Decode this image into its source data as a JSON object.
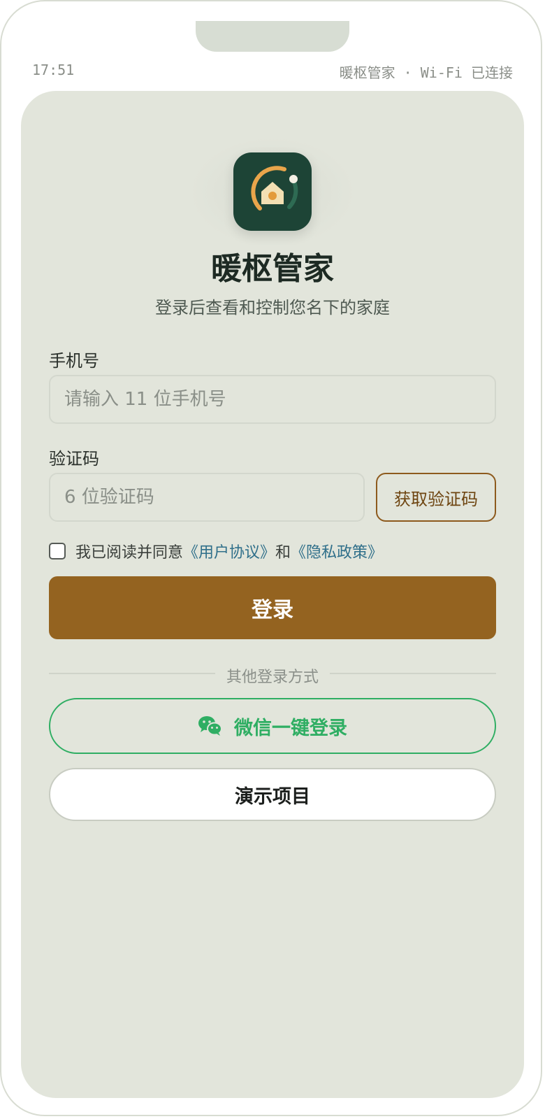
{
  "status_bar": {
    "time": "17:51",
    "right_text": "暖枢管家 · Wi-Fi 已连接"
  },
  "app": {
    "title": "暖枢管家",
    "subtitle": "登录后查看和控制您名下的家庭",
    "logo_icon": "home-gauge-icon"
  },
  "form": {
    "phone_label": "手机号",
    "phone_placeholder": "请输入 11 位手机号",
    "phone_value": "",
    "code_label": "验证码",
    "code_placeholder": "6 位验证码",
    "code_value": "",
    "get_code_label": "获取验证码",
    "agree_prefix": "我已阅读并同意",
    "user_agreement": "《用户协议》",
    "agree_and": "和",
    "privacy_policy": "《隐私政策》",
    "agree_checked": false,
    "login_label": "登录"
  },
  "alt_login": {
    "divider_text": "其他登录方式",
    "wechat_label": "微信一键登录",
    "wechat_icon": "wechat-icon",
    "demo_label": "演示项目"
  },
  "colors": {
    "brand_dark": "#1d4436",
    "primary_button": "#946320",
    "wechat_green": "#2fae63",
    "link": "#2f6f8a",
    "card_bg": "#e2e5db"
  }
}
